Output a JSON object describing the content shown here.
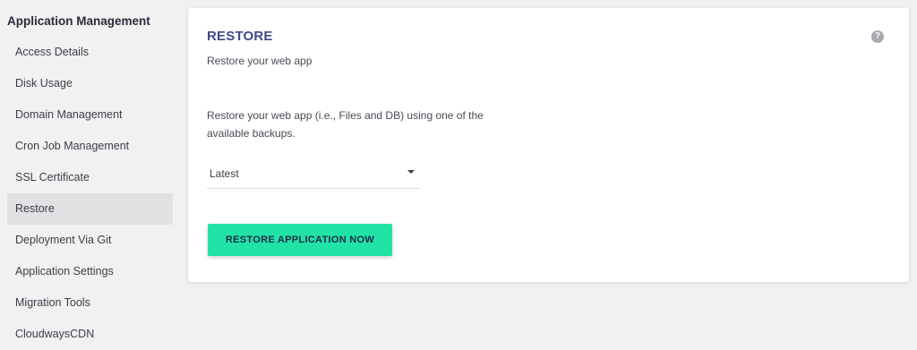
{
  "sidebar": {
    "heading": "Application Management",
    "items": [
      {
        "label": "Access Details"
      },
      {
        "label": "Disk Usage"
      },
      {
        "label": "Domain Management"
      },
      {
        "label": "Cron Job Management"
      },
      {
        "label": "SSL Certificate"
      },
      {
        "label": "Restore",
        "active": true
      },
      {
        "label": "Deployment Via Git"
      },
      {
        "label": "Application Settings"
      },
      {
        "label": "Migration Tools"
      },
      {
        "label": "CloudwaysCDN"
      }
    ]
  },
  "main": {
    "title": "RESTORE",
    "subtitle": "Restore your web app",
    "help_icon": "question-circle-icon",
    "description": "Restore your web app (i.e., Files and DB) using one of the available backups.",
    "backup_select": {
      "value": "Latest"
    },
    "restore_button_label": "RESTORE APPLICATION NOW"
  },
  "colors": {
    "accent": "#22e3a6",
    "title": "#3f4a8a",
    "active_item_bg": "#e1e1e3",
    "page_bg": "#f1f1f2"
  }
}
